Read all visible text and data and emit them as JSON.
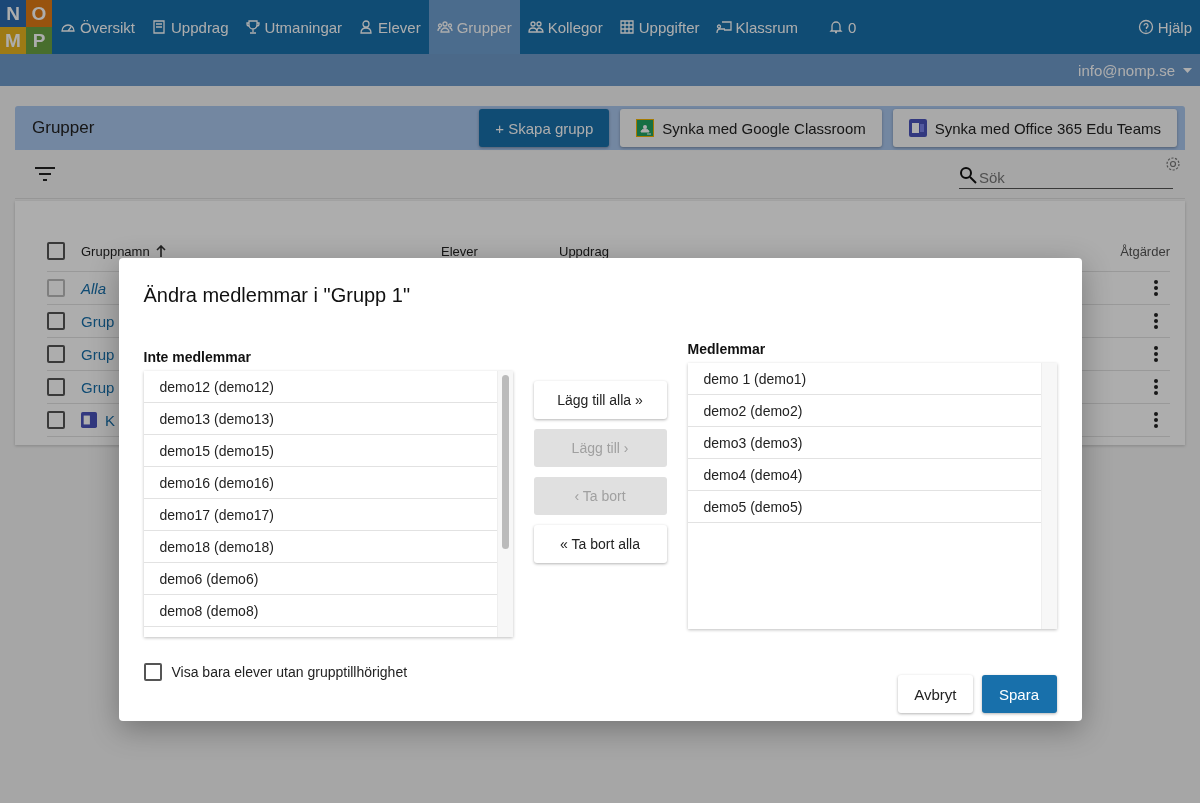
{
  "logo": [
    "N",
    "O",
    "M",
    "P"
  ],
  "nav": [
    {
      "label": "Översikt",
      "selected": false
    },
    {
      "label": "Uppdrag",
      "selected": false
    },
    {
      "label": "Utmaningar",
      "selected": false
    },
    {
      "label": "Elever",
      "selected": false
    },
    {
      "label": "Grupper",
      "selected": true
    },
    {
      "label": "Kollegor",
      "selected": false
    },
    {
      "label": "Uppgifter",
      "selected": false
    },
    {
      "label": "Klassrum",
      "selected": false
    }
  ],
  "notifications": "0",
  "help": "Hjälp",
  "user": "info@nomp.se",
  "page": {
    "title": "Grupper",
    "buttons": [
      "+ Skapa grupp",
      "Synka med Google Classroom",
      "Synka med Office 365 Edu Teams"
    ]
  },
  "search": {
    "placeholder": "Sök"
  },
  "table": {
    "select_all_checked": false,
    "columns": [
      "Gruppnamn",
      "Elever",
      "Uppdrag",
      "Åtgärder"
    ],
    "rows": [
      {
        "name": "Alla",
        "checked": false,
        "disabled": true,
        "kind": "all"
      },
      {
        "name": "Grup",
        "checked": false,
        "disabled": false,
        "kind": "group"
      },
      {
        "name": "Grup",
        "checked": false,
        "disabled": false,
        "kind": "group"
      },
      {
        "name": "Grup",
        "checked": false,
        "disabled": false,
        "kind": "group"
      },
      {
        "name": "K",
        "checked": false,
        "disabled": false,
        "kind": "teams"
      }
    ]
  },
  "dialog": {
    "title": "Ändra medlemmar i \"Grupp 1\"",
    "left": {
      "title": "Inte medlemmar",
      "items": [
        "demo12 (demo12)",
        "demo13 (demo13)",
        "demo15 (demo15)",
        "demo16 (demo16)",
        "demo17 (demo17)",
        "demo18 (demo18)",
        "demo6 (demo6)",
        "demo8 (demo8)"
      ]
    },
    "right": {
      "title": "Medlemmar",
      "items": [
        "demo 1 (demo1)",
        "demo2 (demo2)",
        "demo3 (demo3)",
        "demo4 (demo4)",
        "demo5 (demo5)"
      ]
    },
    "moves": [
      {
        "label": "Lägg till alla »",
        "disabled": false
      },
      {
        "label": "Lägg till ›",
        "disabled": true
      },
      {
        "label": "‹ Ta bort",
        "disabled": true
      },
      {
        "label": "« Ta bort alla",
        "disabled": false
      }
    ],
    "filter": {
      "label": "Visa bara elever utan grupptillhörighet",
      "checked": false
    },
    "cancel": "Avbryt",
    "save": "Spara"
  }
}
